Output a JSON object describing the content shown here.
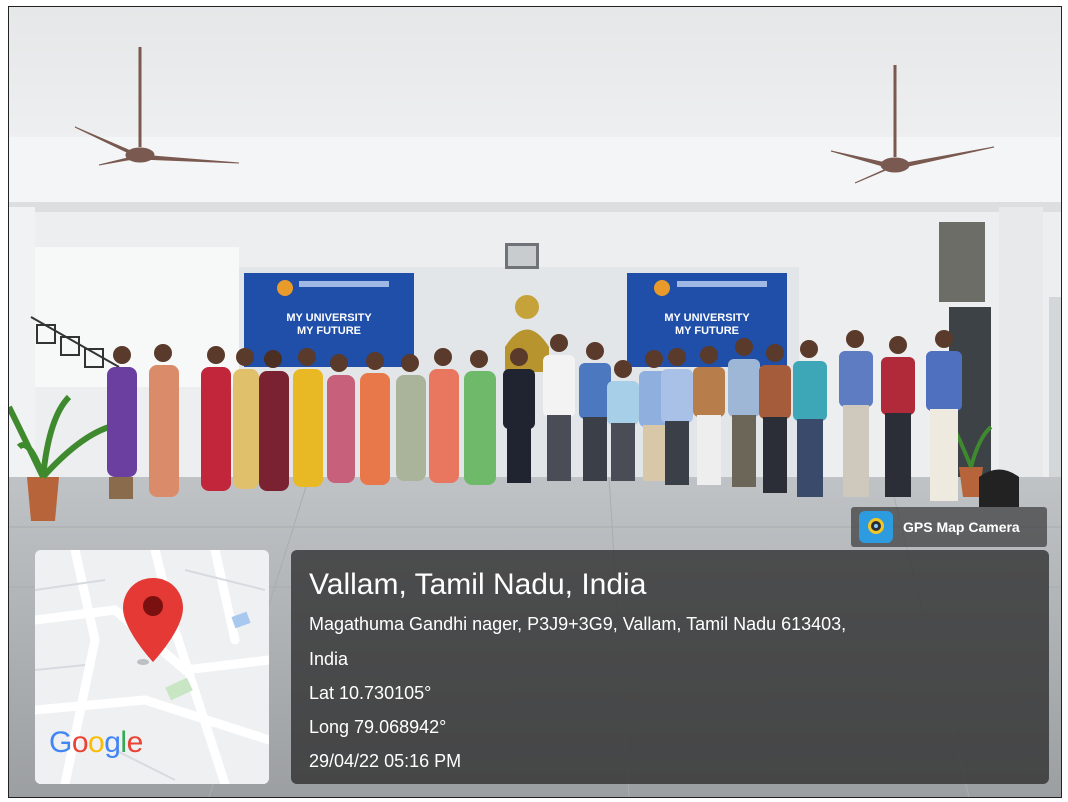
{
  "gps_badge": {
    "label": "GPS Map Camera"
  },
  "map": {
    "logo_letters": [
      "G",
      "o",
      "o",
      "g",
      "l",
      "e"
    ],
    "logo_colors": [
      "#4285F4",
      "#EA4335",
      "#FBBC05",
      "#4285F4",
      "#34A853",
      "#EA4335"
    ],
    "pin_color": "#E53935"
  },
  "location": {
    "title": "Vallam, Tamil Nadu, India",
    "address_line1": "Magathuma Gandhi nager, P3J9+3G9, Vallam, Tamil Nadu 613403,",
    "address_line2": "India",
    "latitude": "Lat 10.730105°",
    "longitude": "Long 79.068942°",
    "datetime": "29/04/22 05:16 PM"
  },
  "banners": {
    "left_text": [
      "MY UNIVERSITY",
      "MY FUTURE"
    ],
    "right_text": [
      "MY UNIVERSITY",
      "MY FUTURE"
    ],
    "color": "#1f4fa8"
  }
}
